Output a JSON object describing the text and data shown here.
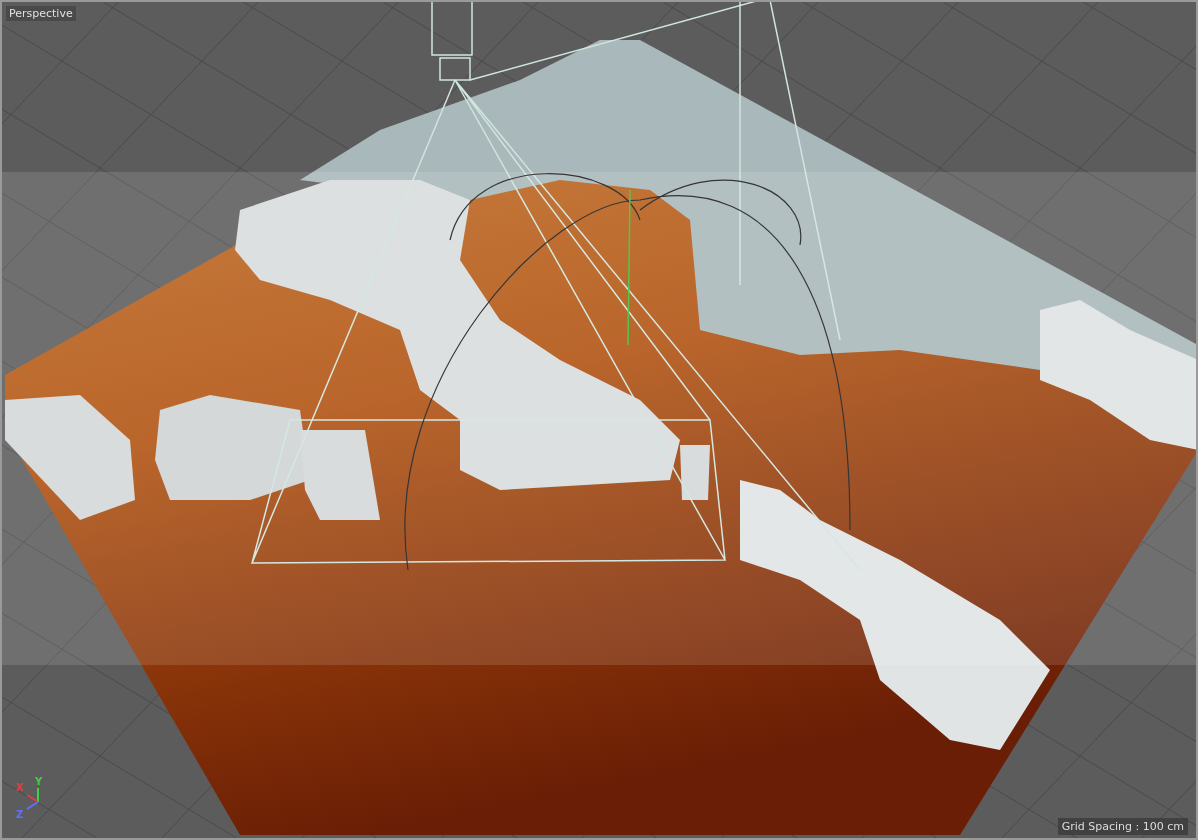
{
  "viewport": {
    "title": "Perspective",
    "grid_spacing": "Grid Spacing : 100 cm"
  },
  "axes": [
    {
      "label": "X",
      "color": "#e04040"
    },
    {
      "label": "Y",
      "color": "#40d040"
    },
    {
      "label": "Z",
      "color": "#6070ff"
    }
  ]
}
